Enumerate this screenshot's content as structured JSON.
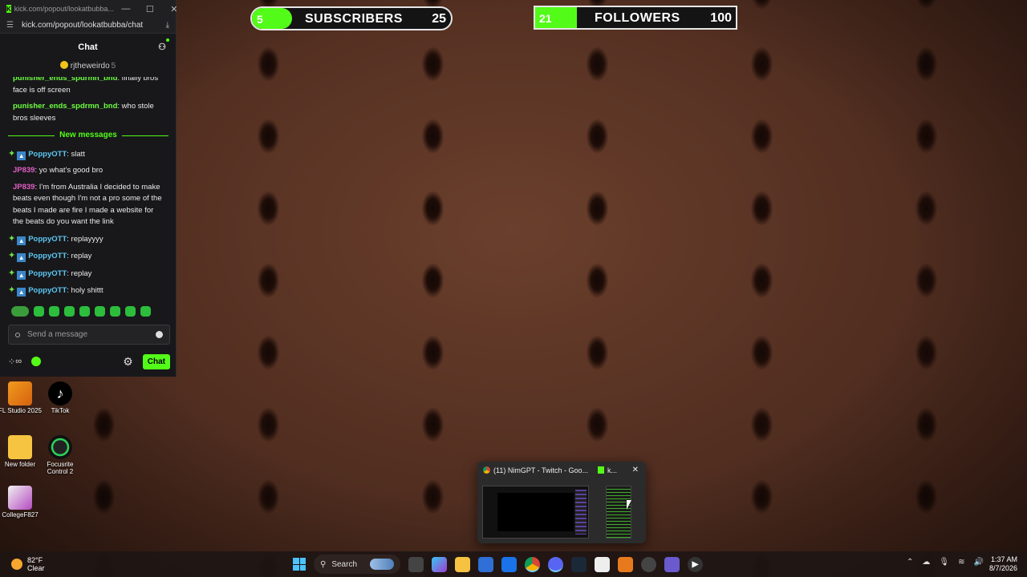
{
  "goals": {
    "subscribers": {
      "current": "5",
      "label": "SUBSCRIBERS",
      "target": "25",
      "progress": 0.2
    },
    "followers": {
      "current": "21",
      "label": "FOLLOWERS",
      "target": "100",
      "progress": 0.21
    }
  },
  "chat_window": {
    "tab_title": "kick.com/popout/lookatbubba...",
    "url": "kick.com/popout/lookatbubba/chat",
    "header": "Chat",
    "pinned_user": "rjtheweirdo",
    "pinned_count": "5",
    "messages_before": [
      {
        "user": "punisher_ends_spdrmn_bnd",
        "text": "finally bros face is off screen"
      },
      {
        "user": "punisher_ends_spdrmn_bnd",
        "text": "who stole bros sleeves"
      }
    ],
    "new_messages_label": "New messages",
    "messages": [
      {
        "user": "PoppyOTT",
        "text": "slatt",
        "badges": true,
        "color": "blue"
      },
      {
        "user": "JP839",
        "text": "yo what's good bro",
        "badges": false,
        "color": "pink"
      },
      {
        "user": "JP839",
        "text": "I'm from Australia I decided to make beats even though I'm not a pro some of the beats I made are fire I made a website for the beats do you want the link",
        "badges": false,
        "color": "pink"
      },
      {
        "user": "PoppyOTT",
        "text": "replayyyy",
        "badges": true,
        "color": "blue"
      },
      {
        "user": "PoppyOTT",
        "text": "replay",
        "badges": true,
        "color": "blue"
      },
      {
        "user": "PoppyOTT",
        "text": "replay",
        "badges": true,
        "color": "blue"
      },
      {
        "user": "PoppyOTT",
        "text": "holy shittt",
        "badges": true,
        "color": "blue"
      }
    ],
    "input_placeholder": "Send a message",
    "footer_infinity": "∞",
    "chat_button": "Chat"
  },
  "desktop_icons": [
    {
      "label": "FL Studio 2025",
      "icon": "fl-studio-icon"
    },
    {
      "label": "TikTok",
      "icon": "tiktok-icon"
    },
    {
      "label": "New folder",
      "icon": "folder-icon"
    },
    {
      "label": "Focusrite Control 2",
      "icon": "focusrite-icon"
    },
    {
      "label": "CollegeF827",
      "icon": "college-icon"
    }
  ],
  "thumbnail_popup": {
    "window1_title": "(11) NimGPT - Twitch - Goo...",
    "window2_title": "k...",
    "close": "✕"
  },
  "taskbar": {
    "weather_temp": "82°F",
    "weather_desc": "Clear",
    "search_label": "Search",
    "time": "1:37 AM",
    "date": "8/7/2026"
  }
}
